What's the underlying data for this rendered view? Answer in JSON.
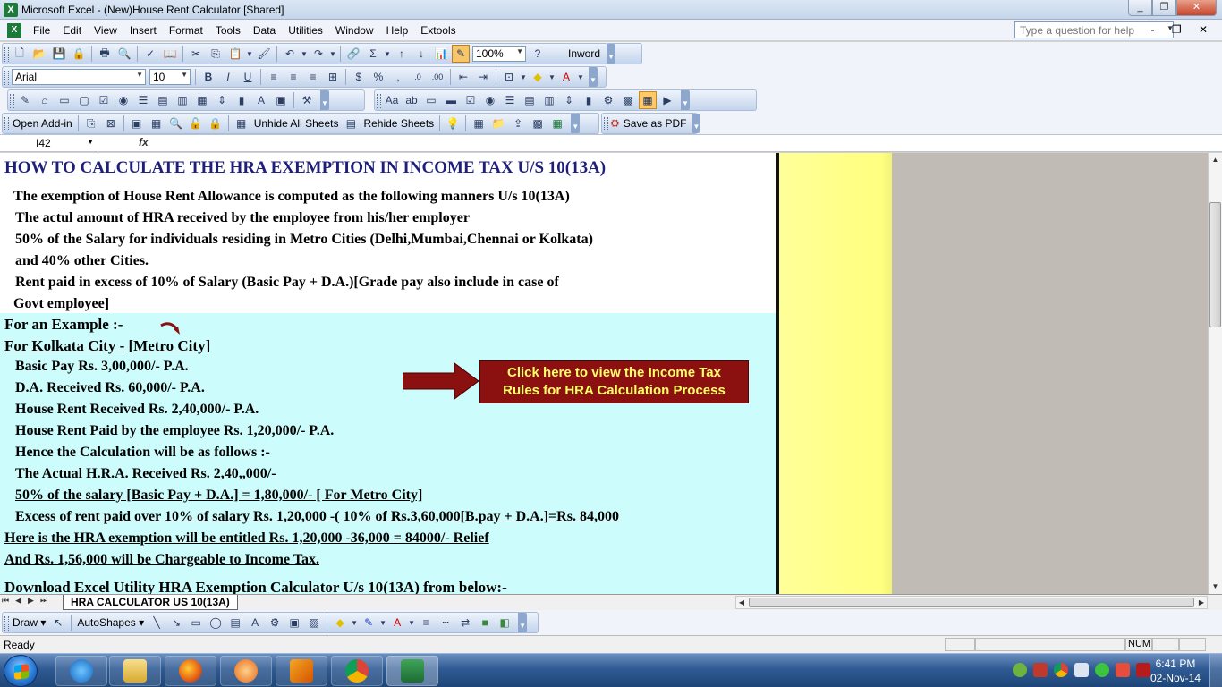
{
  "window": {
    "title": "Microsoft Excel - (New)House Rent Calculator  [Shared]",
    "btn_min": "_",
    "btn_max": "❐",
    "btn_close": "✕"
  },
  "menu": {
    "items": [
      "File",
      "Edit",
      "View",
      "Insert",
      "Format",
      "Tools",
      "Data",
      "Utilities",
      "Window",
      "Help",
      "Extools"
    ],
    "help_placeholder": "Type a question for help",
    "mdi": "- ❐ ✕"
  },
  "toolbar_standard": {
    "zoom": "100%",
    "inword_label": "Inword"
  },
  "toolbar_format": {
    "font": "Arial",
    "size": "10"
  },
  "toolbar_addins": {
    "open_addin": "Open Add-in",
    "unhide_all": "Unhide All Sheets",
    "rehide": "Rehide Sheets",
    "save_pdf": "Save as PDF"
  },
  "formula_bar": {
    "cell_ref": "I42",
    "fx": "fx"
  },
  "sheet": {
    "heading": "HOW TO CALCULATE THE HRA EXEMPTION IN INCOME TAX U/S 10(13A)",
    "intro": [
      "The exemption of House Rent Allowance is computed as the following manners U/s 10(13A)",
      "The actul amount of HRA received by the employee from his/her employer",
      "50% of the Salary for individuals residing in Metro Cities (Delhi,Mumbai,Chennai or Kolkata)",
      "and 40% other Cities.",
      "Rent paid in excess of 10% of Salary (Basic Pay + D.A.)[Grade pay also include in case of",
      "Govt employee]"
    ],
    "example_title": "For an Example :-",
    "city_title": "For Kolkata City - [Metro City]",
    "example": [
      "Basic Pay Rs. 3,00,000/- P.A.",
      "D.A. Received Rs. 60,000/- P.A.",
      "House Rent Received Rs. 2,40,000/- P.A.",
      "House Rent Paid by the employee Rs. 1,20,000/- P.A.",
      "Hence the Calculation will be as follows :-",
      "The Actual H.R.A. Received Rs. 2,40,,000/-",
      "50% of the salary [Basic Pay + D.A.] = 1,80,000/- [ For Metro City]",
      "Excess of rent paid over 10% of salary Rs. 1,20,000 -( 10% of Rs.3,60,000[B.pay + D.A.]=Rs. 84,000"
    ],
    "result1": "Here is the HRA exemption will be entitled Rs. 1,20,000 -36,000 = 84000/- Relief",
    "result2": "And Rs. 1,56,000  will be Chargeable to Income Tax.",
    "download": "Download Excel Utility HRA Exemption Calculator U/s 10(13A) from below:-",
    "button_line1": "Click here to view the Income Tax",
    "button_line2": "Rules for HRA Calculation Process"
  },
  "tabs": {
    "active": "HRA CALCULATOR US 10(13A)"
  },
  "drawing": {
    "draw": "Draw",
    "autoshapes": "AutoShapes"
  },
  "status": {
    "ready": "Ready",
    "num": "NUM"
  },
  "taskbar": {
    "time": "6:41 PM",
    "date": "02-Nov-14"
  },
  "colors": {
    "heading": "#1f1f7a",
    "button_bg": "#8b1010",
    "button_text": "#ffff66",
    "cyan": "#ccfcfc",
    "yellow": "#ffff99"
  }
}
